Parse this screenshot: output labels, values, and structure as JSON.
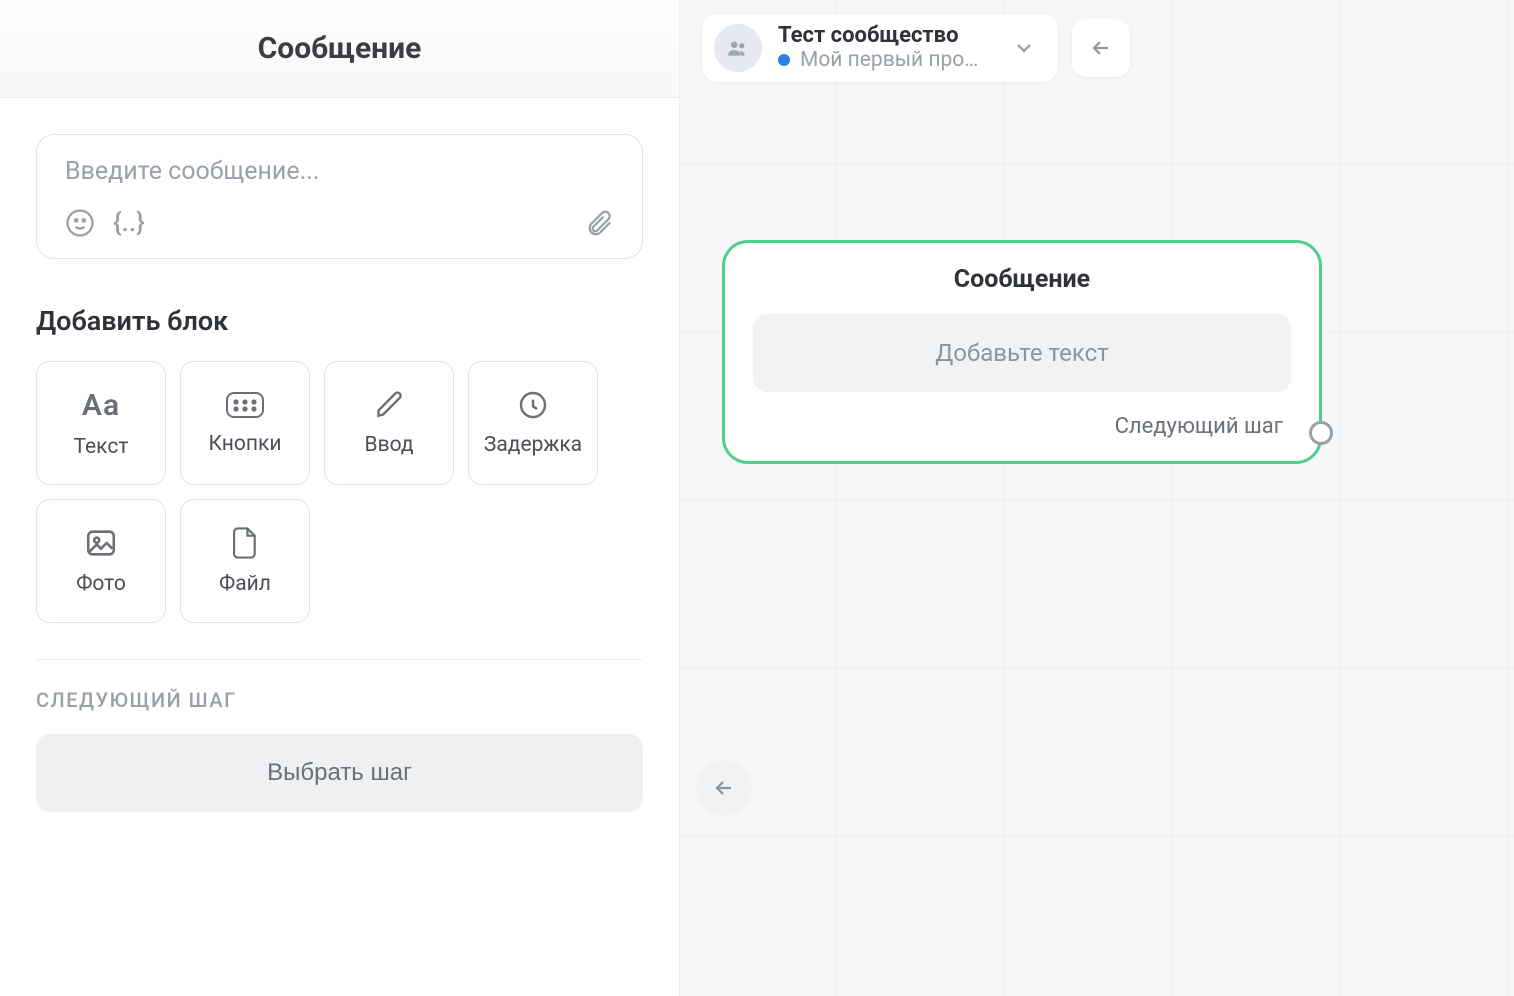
{
  "panel": {
    "title": "Сообщение",
    "message_placeholder": "Введите сообщение...",
    "add_block_heading": "Добавить блок",
    "blocks": {
      "text": "Текст",
      "buttons": "Кнопки",
      "input": "Ввод",
      "delay": "Задержка",
      "photo": "Фото",
      "file": "Файл"
    },
    "text_icon_glyph": "Aa",
    "next_step_caption": "СЛЕДУЮЩИЙ ШАГ",
    "choose_step_label": "Выбрать шаг"
  },
  "canvas": {
    "project_title": "Тест сообщество",
    "project_subtitle": "Мой первый про…",
    "node_title": "Сообщение",
    "node_placeholder": "Добавьте текст",
    "node_next": "Следующий шаг"
  }
}
